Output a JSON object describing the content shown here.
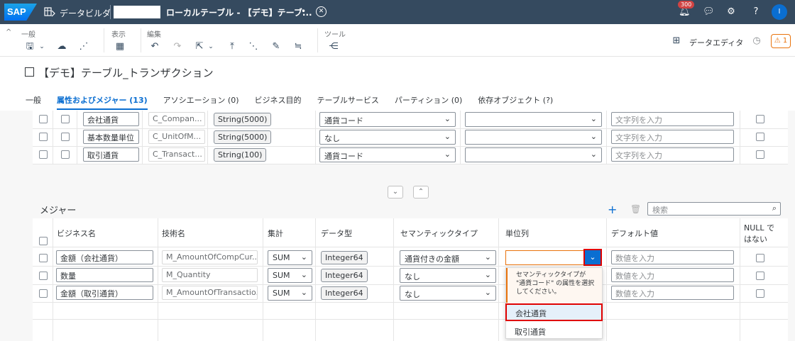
{
  "shell": {
    "logo": "SAP",
    "app_name": "データビルダ",
    "title": "ローカルテーブル - 【デモ】テーブ...",
    "unsaved_dot": "•",
    "notification_count": "300",
    "avatar_initial": "I"
  },
  "toolbar": {
    "group_general": "一般",
    "group_view": "表示",
    "group_edit": "編集",
    "group_tools": "ツール",
    "data_editor": "データエディタ",
    "warning_count": "1"
  },
  "header": {
    "title": "【デモ】テーブル_トランザクション",
    "tabs": [
      {
        "label": "一般"
      },
      {
        "label": "属性およびメジャー (13)"
      },
      {
        "label": "アソシエーション (0)"
      },
      {
        "label": "ビジネス目的"
      },
      {
        "label": "テーブルサービス"
      },
      {
        "label": "パーティション (0)"
      },
      {
        "label": "依存オブジェクト (?)"
      }
    ]
  },
  "attributes": {
    "rows": [
      {
        "business_name": "会社通貨",
        "technical_name": "C_Compan...",
        "data_type": "String(5000)",
        "semantic_type": "通貨コード",
        "default_placeholder": "文字列を入力"
      },
      {
        "business_name": "基本数量単位",
        "technical_name": "C_UnitOfM...",
        "data_type": "String(5000)",
        "semantic_type": "なし",
        "default_placeholder": "文字列を入力"
      },
      {
        "business_name": "取引通貨",
        "technical_name": "C_Transact...",
        "data_type": "String(100)",
        "semantic_type": "通貨コード",
        "default_placeholder": "文字列を入力"
      }
    ]
  },
  "measures": {
    "title": "メジャー",
    "search_placeholder": "検索",
    "headers": {
      "business_name": "ビジネス名",
      "technical_name": "技術名",
      "aggregation": "集計",
      "data_type": "データ型",
      "semantic_type": "セマンティックタイプ",
      "unit_column": "単位列",
      "default_value": "デフォルト値",
      "not_null_line1": "NULL で",
      "not_null_line2": "はない"
    },
    "rows": [
      {
        "business_name": "金額（会社通貨）",
        "technical_name": "M_AmountOfCompCur...",
        "aggregation": "SUM",
        "data_type": "Integer64",
        "semantic_type": "通貨付きの金額",
        "default_placeholder": "数値を入力"
      },
      {
        "business_name": "数量",
        "technical_name": "M_Quantity",
        "aggregation": "SUM",
        "data_type": "Integer64",
        "semantic_type": "なし",
        "default_placeholder": "数値を入力"
      },
      {
        "business_name": "金額（取引通貨）",
        "technical_name": "M_AmountOfTransactio...",
        "aggregation": "SUM",
        "data_type": "Integer64",
        "semantic_type": "なし",
        "default_placeholder": "数値を入力"
      }
    ]
  },
  "unit_dropdown": {
    "message": "セマンティックタイプが \"通貨コード\" の属性を選択してください。",
    "options": [
      "会社通貨",
      "取引通貨"
    ]
  },
  "colors": {
    "shell_bg": "#354a5f",
    "accent": "#0a6ed1",
    "warning": "#e9730c",
    "highlight": "#e00000"
  }
}
